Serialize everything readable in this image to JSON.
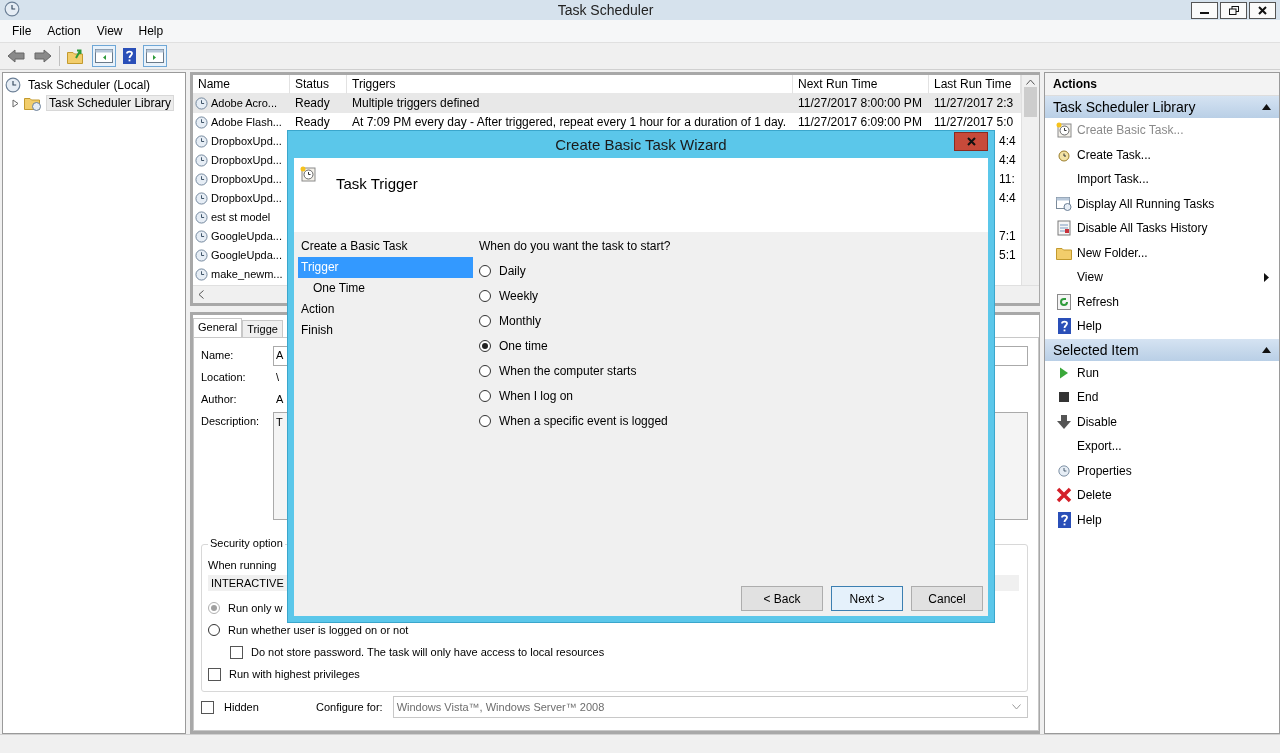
{
  "window": {
    "title": "Task Scheduler"
  },
  "menu": [
    "File",
    "Action",
    "View",
    "Help"
  ],
  "tree": [
    {
      "label": "Task Scheduler (Local)",
      "selected": false,
      "children": [
        {
          "label": "Task Scheduler Library",
          "selected": true,
          "expanded": false
        }
      ]
    }
  ],
  "table": {
    "columns": [
      "Name",
      "Status",
      "Triggers",
      "Next Run Time",
      "Last Run Time"
    ],
    "rows": [
      {
        "name": "Adobe Acro...",
        "status": "Ready",
        "triggers": "Multiple triggers defined",
        "next_run": "11/27/2017 8:00:00 PM",
        "last_run": "11/27/2017 2:3",
        "selected": true
      },
      {
        "name": "Adobe Flash...",
        "status": "Ready",
        "triggers": "At 7:09 PM every day - After triggered, repeat every 1 hour for a duration of 1 day.",
        "next_run": "11/27/2017 6:09:00 PM",
        "last_run": "11/27/2017 5:0",
        "selected": false
      },
      {
        "name": "DropboxUpd...",
        "last_run_tail": "4:4",
        "selected": false
      },
      {
        "name": "DropboxUpd...",
        "last_run_tail": "4:4",
        "selected": false
      },
      {
        "name": "DropboxUpd...",
        "last_run_tail": "11:",
        "selected": false
      },
      {
        "name": "DropboxUpd...",
        "last_run_tail": "4:4",
        "selected": false
      },
      {
        "name": "est st model",
        "selected": false
      },
      {
        "name": "GoogleUpda...",
        "last_run_tail": "7:1",
        "selected": false
      },
      {
        "name": "GoogleUpda...",
        "last_run_tail": "5:1",
        "selected": false
      },
      {
        "name": "make_newm...",
        "selected": false
      }
    ]
  },
  "details": {
    "tabs": [
      {
        "label": "General",
        "selected": true
      },
      {
        "label": "Trigge",
        "selected": false
      }
    ],
    "fields": [
      {
        "label": "Name:",
        "value": "A",
        "kind": "input"
      },
      {
        "label": "Location:",
        "value": "\\",
        "kind": "text"
      },
      {
        "label": "Author:",
        "value": "A",
        "kind": "text"
      },
      {
        "label": "Description:",
        "value": "T",
        "kind": "area"
      }
    ],
    "security": {
      "legend": "Security option",
      "when_running": "When running",
      "account": "INTERACTIVE",
      "options": [
        {
          "kind": "radio",
          "label": "Run only w",
          "checked": true,
          "disabled": true
        },
        {
          "kind": "radio",
          "label": "Run whether user is logged on or not",
          "checked": false,
          "disabled": false,
          "children": [
            {
              "kind": "checkbox",
              "label": "Do not store password.  The task will only have access to local resources",
              "checked": false,
              "disabled": false
            }
          ]
        },
        {
          "kind": "checkbox",
          "label": "Run with highest privileges",
          "checked": false,
          "disabled": false
        }
      ]
    },
    "hidden": {
      "label": "Hidden",
      "checked": false
    },
    "configure": {
      "label": "Configure for:",
      "value": "Windows Vista™, Windows Server™ 2008"
    }
  },
  "actions": {
    "title": "Actions",
    "sections": [
      {
        "title": "Task Scheduler Library",
        "expanded": true,
        "items": [
          {
            "label": "Create Basic Task...",
            "kind": "wizard",
            "disabled": true
          },
          {
            "label": "Create Task...",
            "kind": "create",
            "disabled": false
          },
          {
            "label": "Import Task...",
            "kind": "plain",
            "disabled": false
          },
          {
            "label": "Display All Running Tasks",
            "kind": "running",
            "disabled": false
          },
          {
            "label": "Disable All Tasks History",
            "kind": "history",
            "disabled": false
          },
          {
            "label": "New Folder...",
            "kind": "folder",
            "disabled": false
          },
          {
            "label": "View",
            "kind": "submenu",
            "disabled": false
          },
          {
            "label": "Refresh",
            "kind": "refresh",
            "disabled": false
          },
          {
            "label": "Help",
            "kind": "help",
            "disabled": false
          }
        ]
      },
      {
        "title": "Selected Item",
        "expanded": true,
        "items": [
          {
            "label": "Run",
            "kind": "run",
            "disabled": false
          },
          {
            "label": "End",
            "kind": "end",
            "disabled": false
          },
          {
            "label": "Disable",
            "kind": "disable",
            "disabled": false
          },
          {
            "label": "Export...",
            "kind": "plain",
            "disabled": false
          },
          {
            "label": "Properties",
            "kind": "properties",
            "disabled": false
          },
          {
            "label": "Delete",
            "kind": "delete",
            "disabled": false
          },
          {
            "label": "Help",
            "kind": "help",
            "disabled": false
          }
        ]
      }
    ]
  },
  "dialog": {
    "title": "Create Basic Task Wizard",
    "heading": "Task Trigger",
    "steps": [
      {
        "label": "Create a Basic Task",
        "selected": false
      },
      {
        "label": "Trigger",
        "selected": true,
        "children": [
          {
            "label": "One Time",
            "selected": false
          }
        ]
      },
      {
        "label": "Action",
        "selected": false
      },
      {
        "label": "Finish",
        "selected": false
      }
    ],
    "question": "When do you want the task to start?",
    "options": [
      {
        "label": "Daily",
        "selected": false
      },
      {
        "label": "Weekly",
        "selected": false
      },
      {
        "label": "Monthly",
        "selected": false
      },
      {
        "label": "One time",
        "selected": true
      },
      {
        "label": "When the computer starts",
        "selected": false
      },
      {
        "label": "When I log on",
        "selected": false
      },
      {
        "label": "When a specific event is logged",
        "selected": false
      }
    ],
    "buttons": [
      {
        "label": "< Back",
        "default": false
      },
      {
        "label": "Next >",
        "default": true
      },
      {
        "label": "Cancel",
        "default": false
      }
    ]
  }
}
